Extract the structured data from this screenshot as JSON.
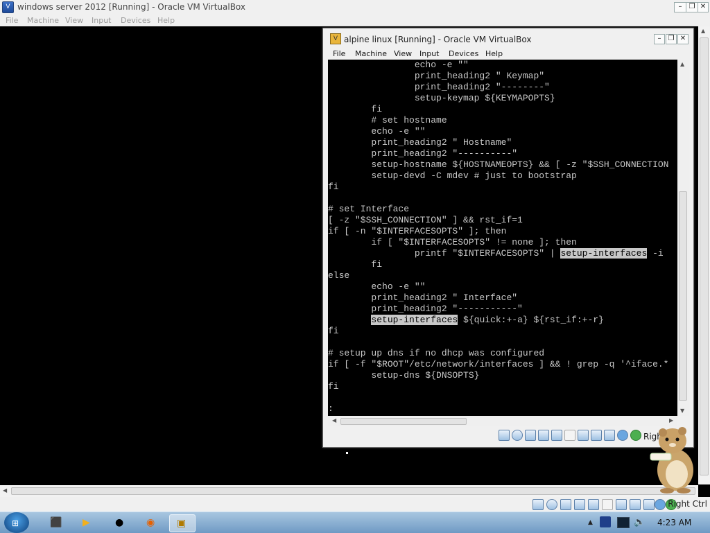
{
  "outer": {
    "title": "windows server 2012 [Running] - Oracle VM VirtualBox",
    "menu": [
      "File",
      "Machine",
      "View",
      "Input",
      "Devices",
      "Help"
    ],
    "host_key": "Right Ctrl"
  },
  "inner": {
    "title": "alpine linux [Running] - Oracle VM VirtualBox",
    "menu": [
      "File",
      "Machine",
      "View",
      "Input",
      "Devices",
      "Help"
    ],
    "host_key": "Right",
    "terminal_lines": [
      {
        "pre": "                echo -e \"\""
      },
      {
        "pre": "                print_heading2 \" Keymap\""
      },
      {
        "pre": "                print_heading2 \"--------\""
      },
      {
        "pre": "                setup-keymap ${KEYMAPOPTS}"
      },
      {
        "pre": "        fi"
      },
      {
        "pre": "        # set hostname"
      },
      {
        "pre": "        echo -e \"\""
      },
      {
        "pre": "        print_heading2 \" Hostname\""
      },
      {
        "pre": "        print_heading2 \"----------\""
      },
      {
        "pre": "        setup-hostname ${HOSTNAMEOPTS} && [ -z \"$SSH_CONNECTION"
      },
      {
        "pre": "        setup-devd -C mdev # just to bootstrap"
      },
      {
        "pre": "fi"
      },
      {
        "pre": ""
      },
      {
        "pre": "# set Interface"
      },
      {
        "pre": "[ -z \"$SSH_CONNECTION\" ] && rst_if=1"
      },
      {
        "pre": "if [ -n \"$INTERFACESOPTS\" ]; then"
      },
      {
        "pre": "        if [ \"$INTERFACESOPTS\" != none ]; then"
      },
      {
        "pre": "                printf \"$INTERFACESOPTS\" | ",
        "hl": "setup-interfaces",
        "post": " -i"
      },
      {
        "pre": "        fi"
      },
      {
        "pre": "else"
      },
      {
        "pre": "        echo -e \"\""
      },
      {
        "pre": "        print_heading2 \" Interface\""
      },
      {
        "pre": "        print_heading2 \"-----------\""
      },
      {
        "pre": "        ",
        "hl": "setup-interfaces",
        "post": " ${quick:+-a} ${rst_if:+-r}"
      },
      {
        "pre": "fi"
      },
      {
        "pre": ""
      },
      {
        "pre": "# setup up dns if no dhcp was configured"
      },
      {
        "pre": "if [ -f \"$ROOT\"/etc/network/interfaces ] && ! grep -q '^iface.*"
      },
      {
        "pre": "        setup-dns ${DNSOPTS}"
      },
      {
        "pre": "fi"
      },
      {
        "pre": ""
      },
      {
        "pre": ":"
      }
    ]
  },
  "taskbar": {
    "clock": "4:23 AM"
  }
}
